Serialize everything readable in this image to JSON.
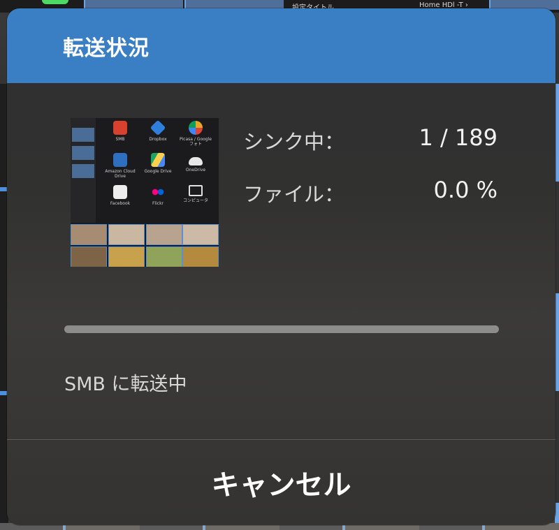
{
  "background": {
    "top_caption_left": "設定タイトル",
    "top_caption_right": "Home HDl -T ›"
  },
  "dialog": {
    "title": "転送状況",
    "sync_label": "シンク中：",
    "sync_value": "1 / 189",
    "file_label": "ファイル：",
    "file_value": "0.0 %",
    "progress": 0.0,
    "status_text": "SMB に転送中",
    "cancel_label": "キャンセル",
    "accent_color": "#3a7fc4"
  },
  "thumbnail": {
    "apps": [
      {
        "label": "SMB",
        "icon": "smb-icon",
        "color": "#d9412f"
      },
      {
        "label": "Dropbox",
        "icon": "dropbox-icon",
        "color": "#2f7fdc"
      },
      {
        "label": "Picasa / Google フォト",
        "icon": "google-photos-icon",
        "color": "#e7a728"
      },
      {
        "label": "Amazon Cloud Drive",
        "icon": "amazon-cloud-drive-icon",
        "color": "#2f6fbf"
      },
      {
        "label": "Google Drive",
        "icon": "google-drive-icon",
        "color": "#1fa463"
      },
      {
        "label": "OneDrive",
        "icon": "onedrive-icon",
        "color": "#e8e8e8"
      },
      {
        "label": "Facebook",
        "icon": "facebook-icon",
        "color": "#eeeeee"
      },
      {
        "label": "Flickr",
        "icon": "flickr-icon",
        "color": "#ff0084"
      },
      {
        "label": "コンピュータ",
        "icon": "computer-icon",
        "color": "#e0e0e0"
      }
    ]
  }
}
